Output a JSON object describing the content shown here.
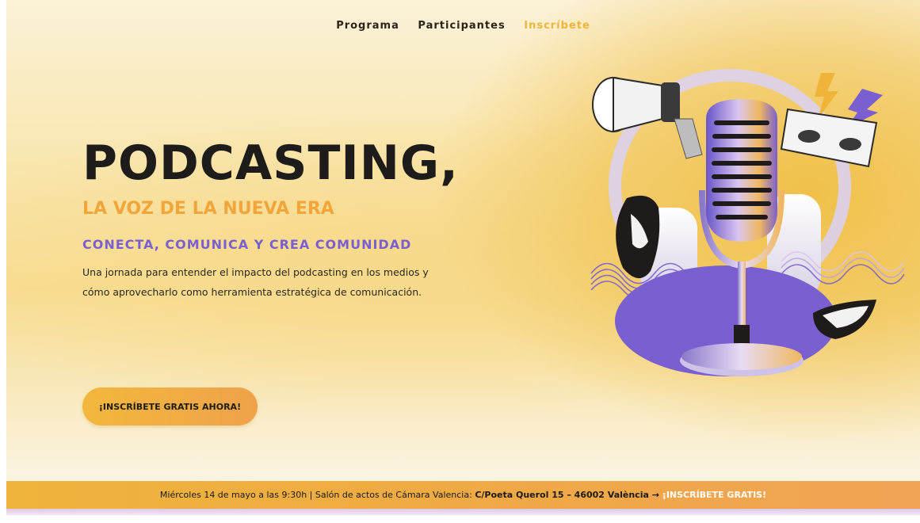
{
  "nav": {
    "items": [
      {
        "label": "Programa"
      },
      {
        "label": "Participantes"
      },
      {
        "label": "Inscríbete"
      }
    ]
  },
  "hero": {
    "title": "PODCASTING,",
    "subtitle": "LA VOZ DE LA NUEVA ERA",
    "tagline": "CONECTA, COMUNICA Y CREA COMUNIDAD",
    "description": "Una jornada para entender el impacto del podcasting en los medios y cómo aprovecharlo como herramienta estratégica de comunicación.",
    "cta_label": "¡INSCRÍBETE GRATIS AHORA!"
  },
  "banner": {
    "info": "Miércoles 14 de mayo a las 9:30h | Salón de actos de Cámara Valencia: ",
    "address": "C/Poeta Querol 15 – 46002 València",
    "arrow": " → ",
    "link_label": "¡INSCRÍBETE GRATIS!"
  },
  "colors": {
    "accent_orange": "#f1a53a",
    "accent_purple": "#7a5fd0",
    "nav_active": "#f0b43a"
  },
  "illustration": {
    "icons": [
      "megaphone-icon",
      "microphone-icon",
      "lightning-icon",
      "mouth-icon",
      "eyes-icon",
      "headphones-icon",
      "sound-wave-icon"
    ]
  }
}
